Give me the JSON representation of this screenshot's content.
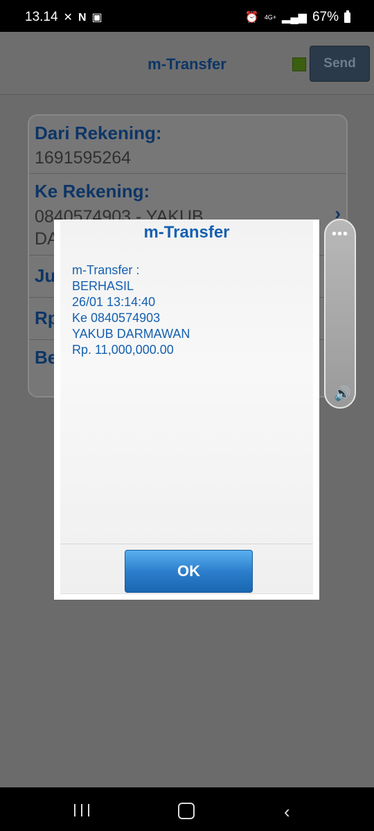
{
  "status_bar": {
    "time": "13.14",
    "network": "4G+",
    "battery": "67%"
  },
  "header": {
    "title": "m-Transfer",
    "send_label": "Send"
  },
  "form": {
    "from_label": "Dari Rekening:",
    "from_value": "1691595264",
    "to_label": "Ke Rekening:",
    "to_value_line1": "0840574903 - YAKUB",
    "to_value_line2": "DA",
    "row3_label": "Ju",
    "row4_label": "Rp",
    "row5_label": "Be"
  },
  "dialog": {
    "title": "m-Transfer",
    "message_lines": [
      "m-Transfer :",
      "BERHASIL",
      "26/01 13:14:40",
      "Ke 0840574903",
      "YAKUB DARMAWAN",
      "Rp. 11,000,000.00"
    ],
    "ok_label": "OK"
  },
  "volume_panel": {
    "dots": "•••"
  },
  "colors": {
    "accent": "#1560b0",
    "title_blue": "#0d3566",
    "ok_button": "#2c7fcc"
  }
}
